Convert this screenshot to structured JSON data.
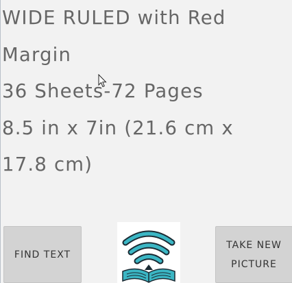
{
  "recognized_text": {
    "lines": [
      "WIDE RULED with Red",
      "Margin",
      "36 Sheets-72 Pages",
      "8.5 in x 7in (21.6 cm x",
      "17.8 cm)"
    ]
  },
  "buttons": {
    "find_text": "FIND TEXT",
    "take_new_picture": [
      "TAKE NEW",
      "PICTURE"
    ]
  },
  "icons": {
    "logo": "signal-book-logo-icon",
    "cursor": "mouse-pointer-icon"
  },
  "colors": {
    "background": "#f2f2f2",
    "text": "#666666",
    "button": "#d3d3d3",
    "logo_teal": "#3bb6c4",
    "logo_dark": "#1b2a33"
  }
}
